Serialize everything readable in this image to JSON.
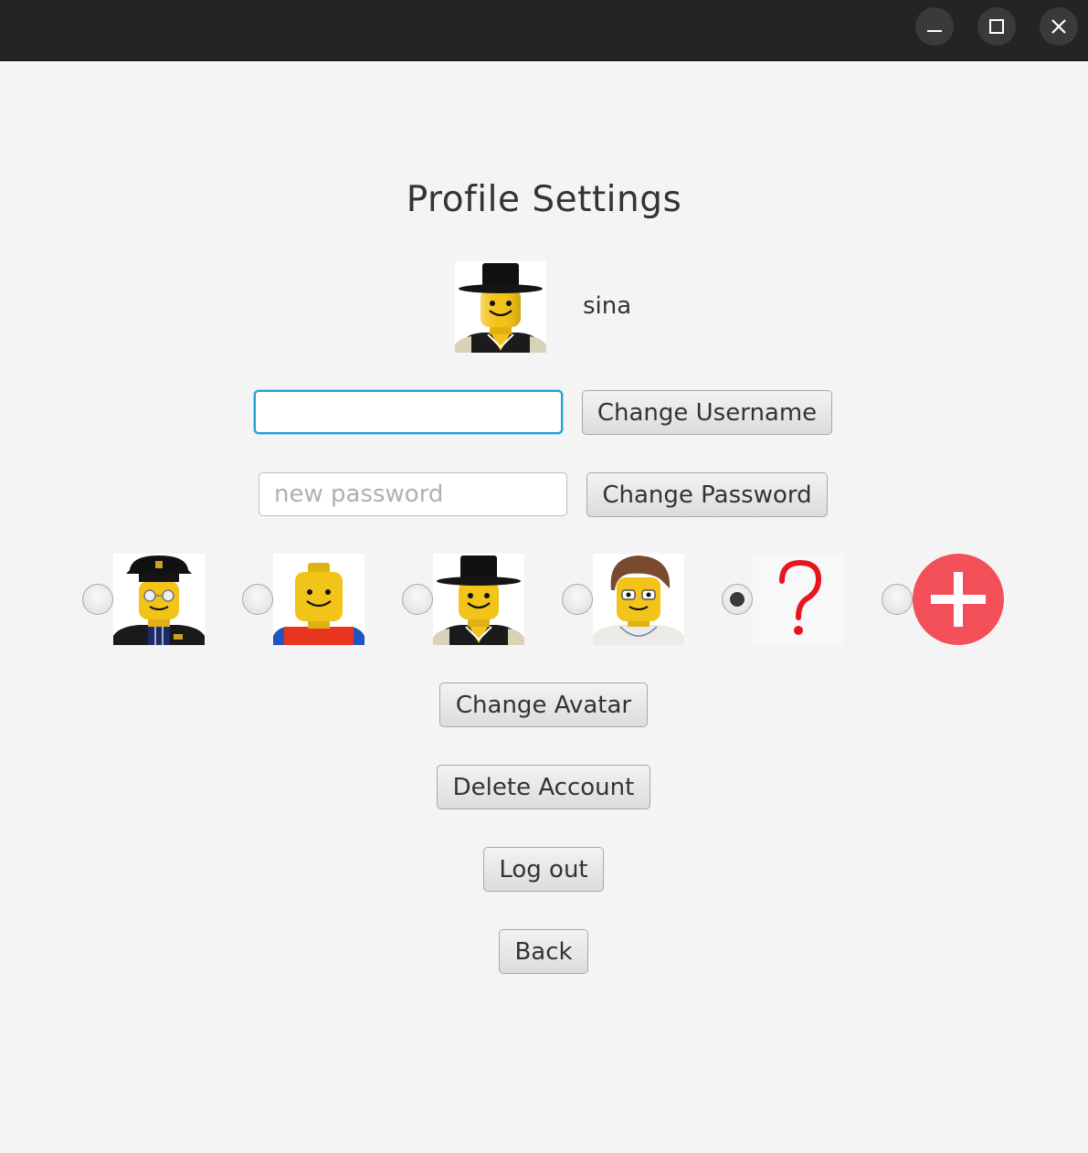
{
  "window": {
    "buttons": [
      {
        "name": "minimize",
        "icon": "minimize-icon"
      },
      {
        "name": "maximize",
        "icon": "maximize-icon"
      },
      {
        "name": "close",
        "icon": "close-icon"
      }
    ]
  },
  "page": {
    "title": "Profile Settings",
    "username": "sina",
    "current_avatar": "lego-minifig-top-hat-avatar"
  },
  "username_form": {
    "value": "",
    "placeholder": "",
    "button_label": "Change Username"
  },
  "password_form": {
    "value": "",
    "placeholder": "new password",
    "button_label": "Change Password"
  },
  "avatars": [
    {
      "id": "police",
      "icon": "lego-minifig-police-avatar",
      "selected": false
    },
    {
      "id": "classic",
      "icon": "lego-minifig-classic-avatar",
      "selected": false
    },
    {
      "id": "tophat",
      "icon": "lego-minifig-top-hat-avatar",
      "selected": false
    },
    {
      "id": "doctor",
      "icon": "lego-minifig-doctor-avatar",
      "selected": false
    },
    {
      "id": "unknown",
      "icon": "question-mark-avatar",
      "selected": true
    },
    {
      "id": "custom",
      "icon": "add-avatar-icon",
      "selected": false
    }
  ],
  "actions": {
    "change_avatar": "Change Avatar",
    "delete_account": "Delete Account",
    "log_out": "Log out",
    "back": "Back"
  },
  "colors": {
    "titlebar": "#242424",
    "background": "#f4f4f4",
    "focus_ring": "#1ea1d8",
    "add_button": "#f4505a",
    "question_mark": "#e8141e",
    "lego_yellow": "#f2c318"
  }
}
